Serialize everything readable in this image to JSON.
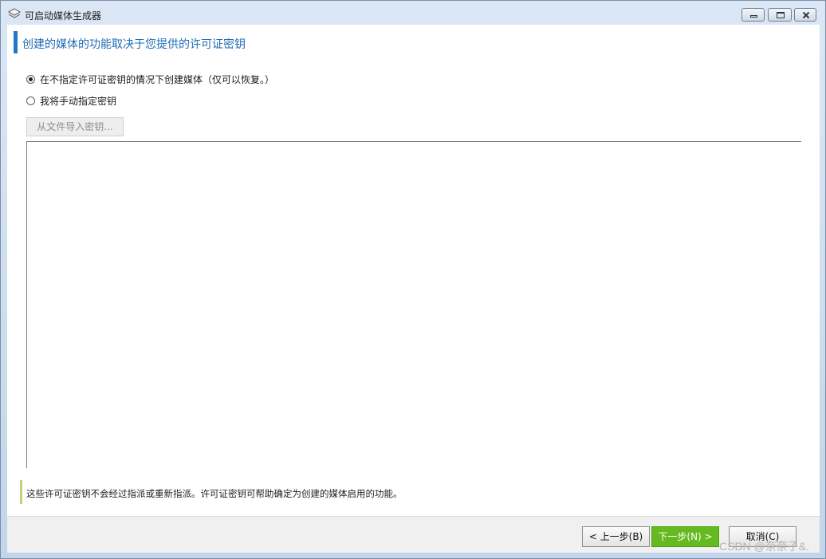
{
  "window": {
    "title": "可启动媒体生成器",
    "icon": "layers-icon"
  },
  "header": {
    "title": "创建的媒体的功能取决于您提供的许可证密钥",
    "accent_color": "#2776c1"
  },
  "options": [
    {
      "label": "在不指定许可证密钥的情况下创建媒体（仅可以恢复。）",
      "checked": true
    },
    {
      "label": "我将手动指定密钥",
      "checked": false
    }
  ],
  "import_button": {
    "label": "从文件导入密钥..."
  },
  "note": {
    "text": "这些许可证密钥不会经过指派或重新指派。许可证密钥可帮助确定为创建的媒体启用的功能。"
  },
  "footer": {
    "back_label": "< 上一步(B)",
    "next_label": "下一步(N) >",
    "cancel_label": "取消(C)",
    "next_color": "#64ba1e"
  },
  "watermark": "CSDN @奈奈子&."
}
